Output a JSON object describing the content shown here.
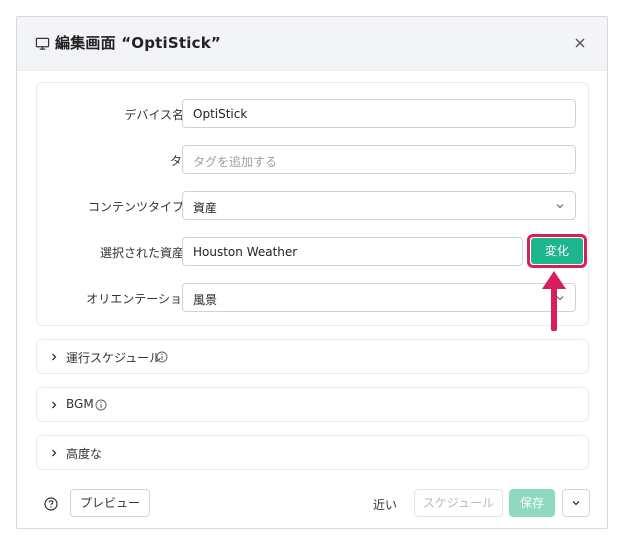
{
  "dialog": {
    "title": "編集画面 “OptiStick”",
    "icons": {
      "title_icon": "monitor-icon",
      "close_icon": "close-icon"
    }
  },
  "form": {
    "device_name": {
      "label": "デバイス名",
      "required_mark": "*",
      "value": "OptiStick"
    },
    "tags": {
      "label": "タグ",
      "placeholder": "タグを追加する"
    },
    "content_type": {
      "label": "コンテンツタイプ",
      "required_mark": "*",
      "value": "資産"
    },
    "selected_asset": {
      "label": "選択された資産",
      "required_mark": "*",
      "value": "Houston Weather",
      "change_label": "変化"
    },
    "orientation": {
      "label": "オリエンテーション",
      "value": "風景"
    }
  },
  "sections": [
    {
      "label": "運行スケジュール",
      "has_info": true
    },
    {
      "label": "BGM",
      "has_info": true
    },
    {
      "label": "高度な",
      "has_info": false
    }
  ],
  "footer": {
    "preview_label": "プレビュー",
    "close_label": "近い",
    "schedule_label": "スケジュール",
    "save_label": "保存"
  },
  "colors": {
    "accent": "#1db58d",
    "highlight": "#d81e5b",
    "required": "#e5484d"
  }
}
